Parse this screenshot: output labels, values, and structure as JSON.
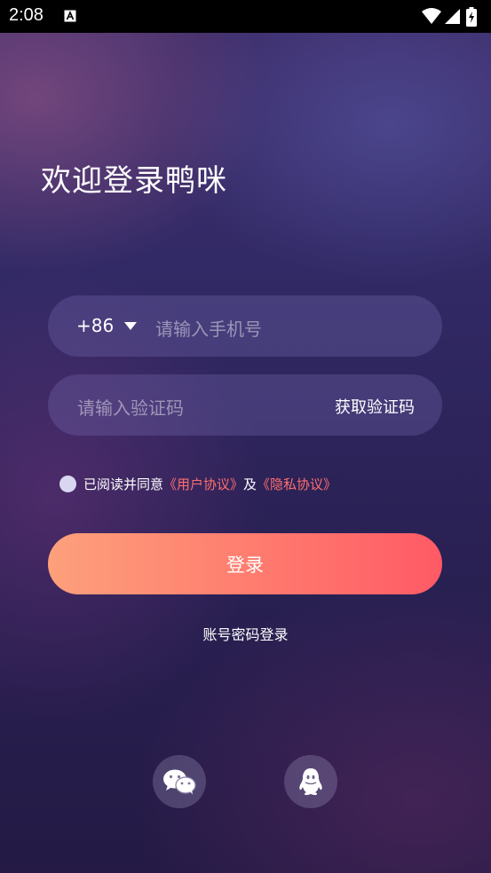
{
  "status_bar": {
    "time": "2:08",
    "icons": [
      "a-notification-icon",
      "wifi-icon",
      "signal-icon",
      "battery-charging-icon"
    ]
  },
  "welcome": {
    "title": "欢迎登录鸭咪"
  },
  "phone_field": {
    "country_code": "+86",
    "placeholder": "请输入手机号",
    "value": ""
  },
  "code_field": {
    "placeholder": "请输入验证码",
    "value": "",
    "get_code_label": "获取验证码"
  },
  "agreement": {
    "prefix": "已阅读并同意",
    "user_agreement": "《用户协议》",
    "and": "及",
    "privacy_policy": "《隐私协议》",
    "checked": false
  },
  "login_button": {
    "label": "登录"
  },
  "account_login": {
    "label": "账号密码登录"
  },
  "social": {
    "items": [
      "wechat-icon",
      "qq-icon"
    ]
  },
  "colors": {
    "accent_link": "#ff6e6e",
    "button_gradient_start": "#fda07b",
    "button_gradient_end": "#ff5a66",
    "background_top": "#3f2e6b",
    "background_bottom": "#241a45"
  }
}
